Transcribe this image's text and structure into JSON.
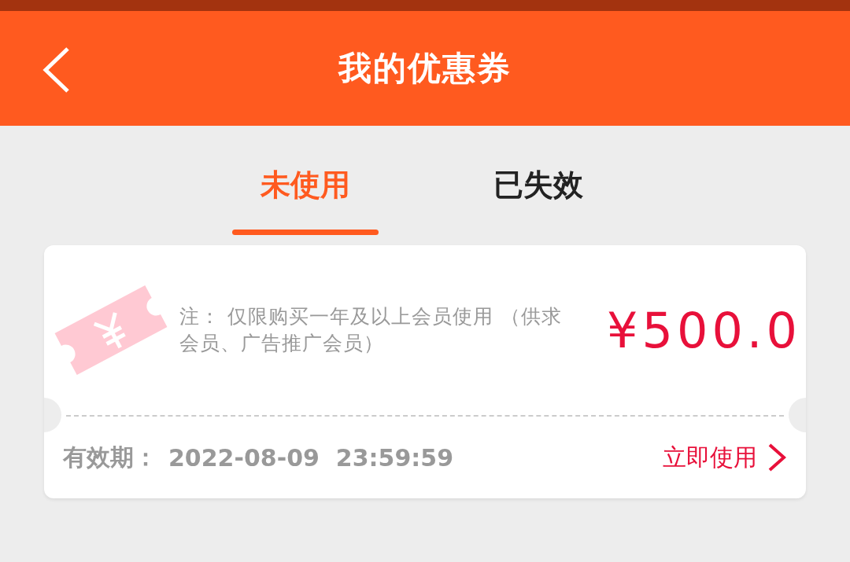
{
  "header": {
    "title": "我的优惠券"
  },
  "tabs": [
    {
      "label": "未使用",
      "selected": true
    },
    {
      "label": "已失效",
      "selected": false
    }
  ],
  "coupons": [
    {
      "note": "注： 仅限购买一年及以上会员使用 （供求会员、广告推广会员）",
      "price": "¥500.0",
      "validity_label": "有效期：",
      "validity_value": "2022-08-09  23:59:59",
      "action": "立即使用"
    }
  ]
}
